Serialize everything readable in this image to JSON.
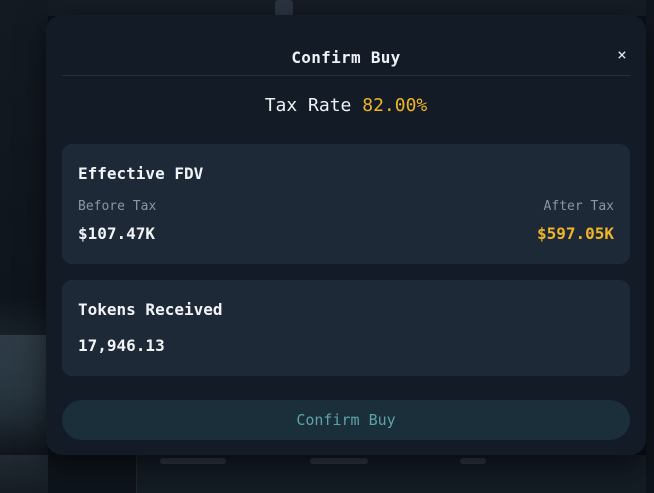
{
  "modal": {
    "title": "Confirm Buy",
    "close_glyph": "×",
    "tax": {
      "label": "Tax Rate",
      "value": "82.00%"
    },
    "fdv": {
      "heading": "Effective FDV",
      "before_label": "Before Tax",
      "before_value": "$107.47K",
      "after_label": "After Tax",
      "after_value": "$597.05K"
    },
    "tokens": {
      "heading": "Tokens Received",
      "value": "17,946.13"
    },
    "confirm_button": "Confirm Buy"
  },
  "colors": {
    "accent_gold": "#f0b428",
    "button_text": "#5fa3a8",
    "modal_bg": "#131b26",
    "card_bg": "#1e2937"
  },
  "icons": {
    "close": "close-icon"
  }
}
